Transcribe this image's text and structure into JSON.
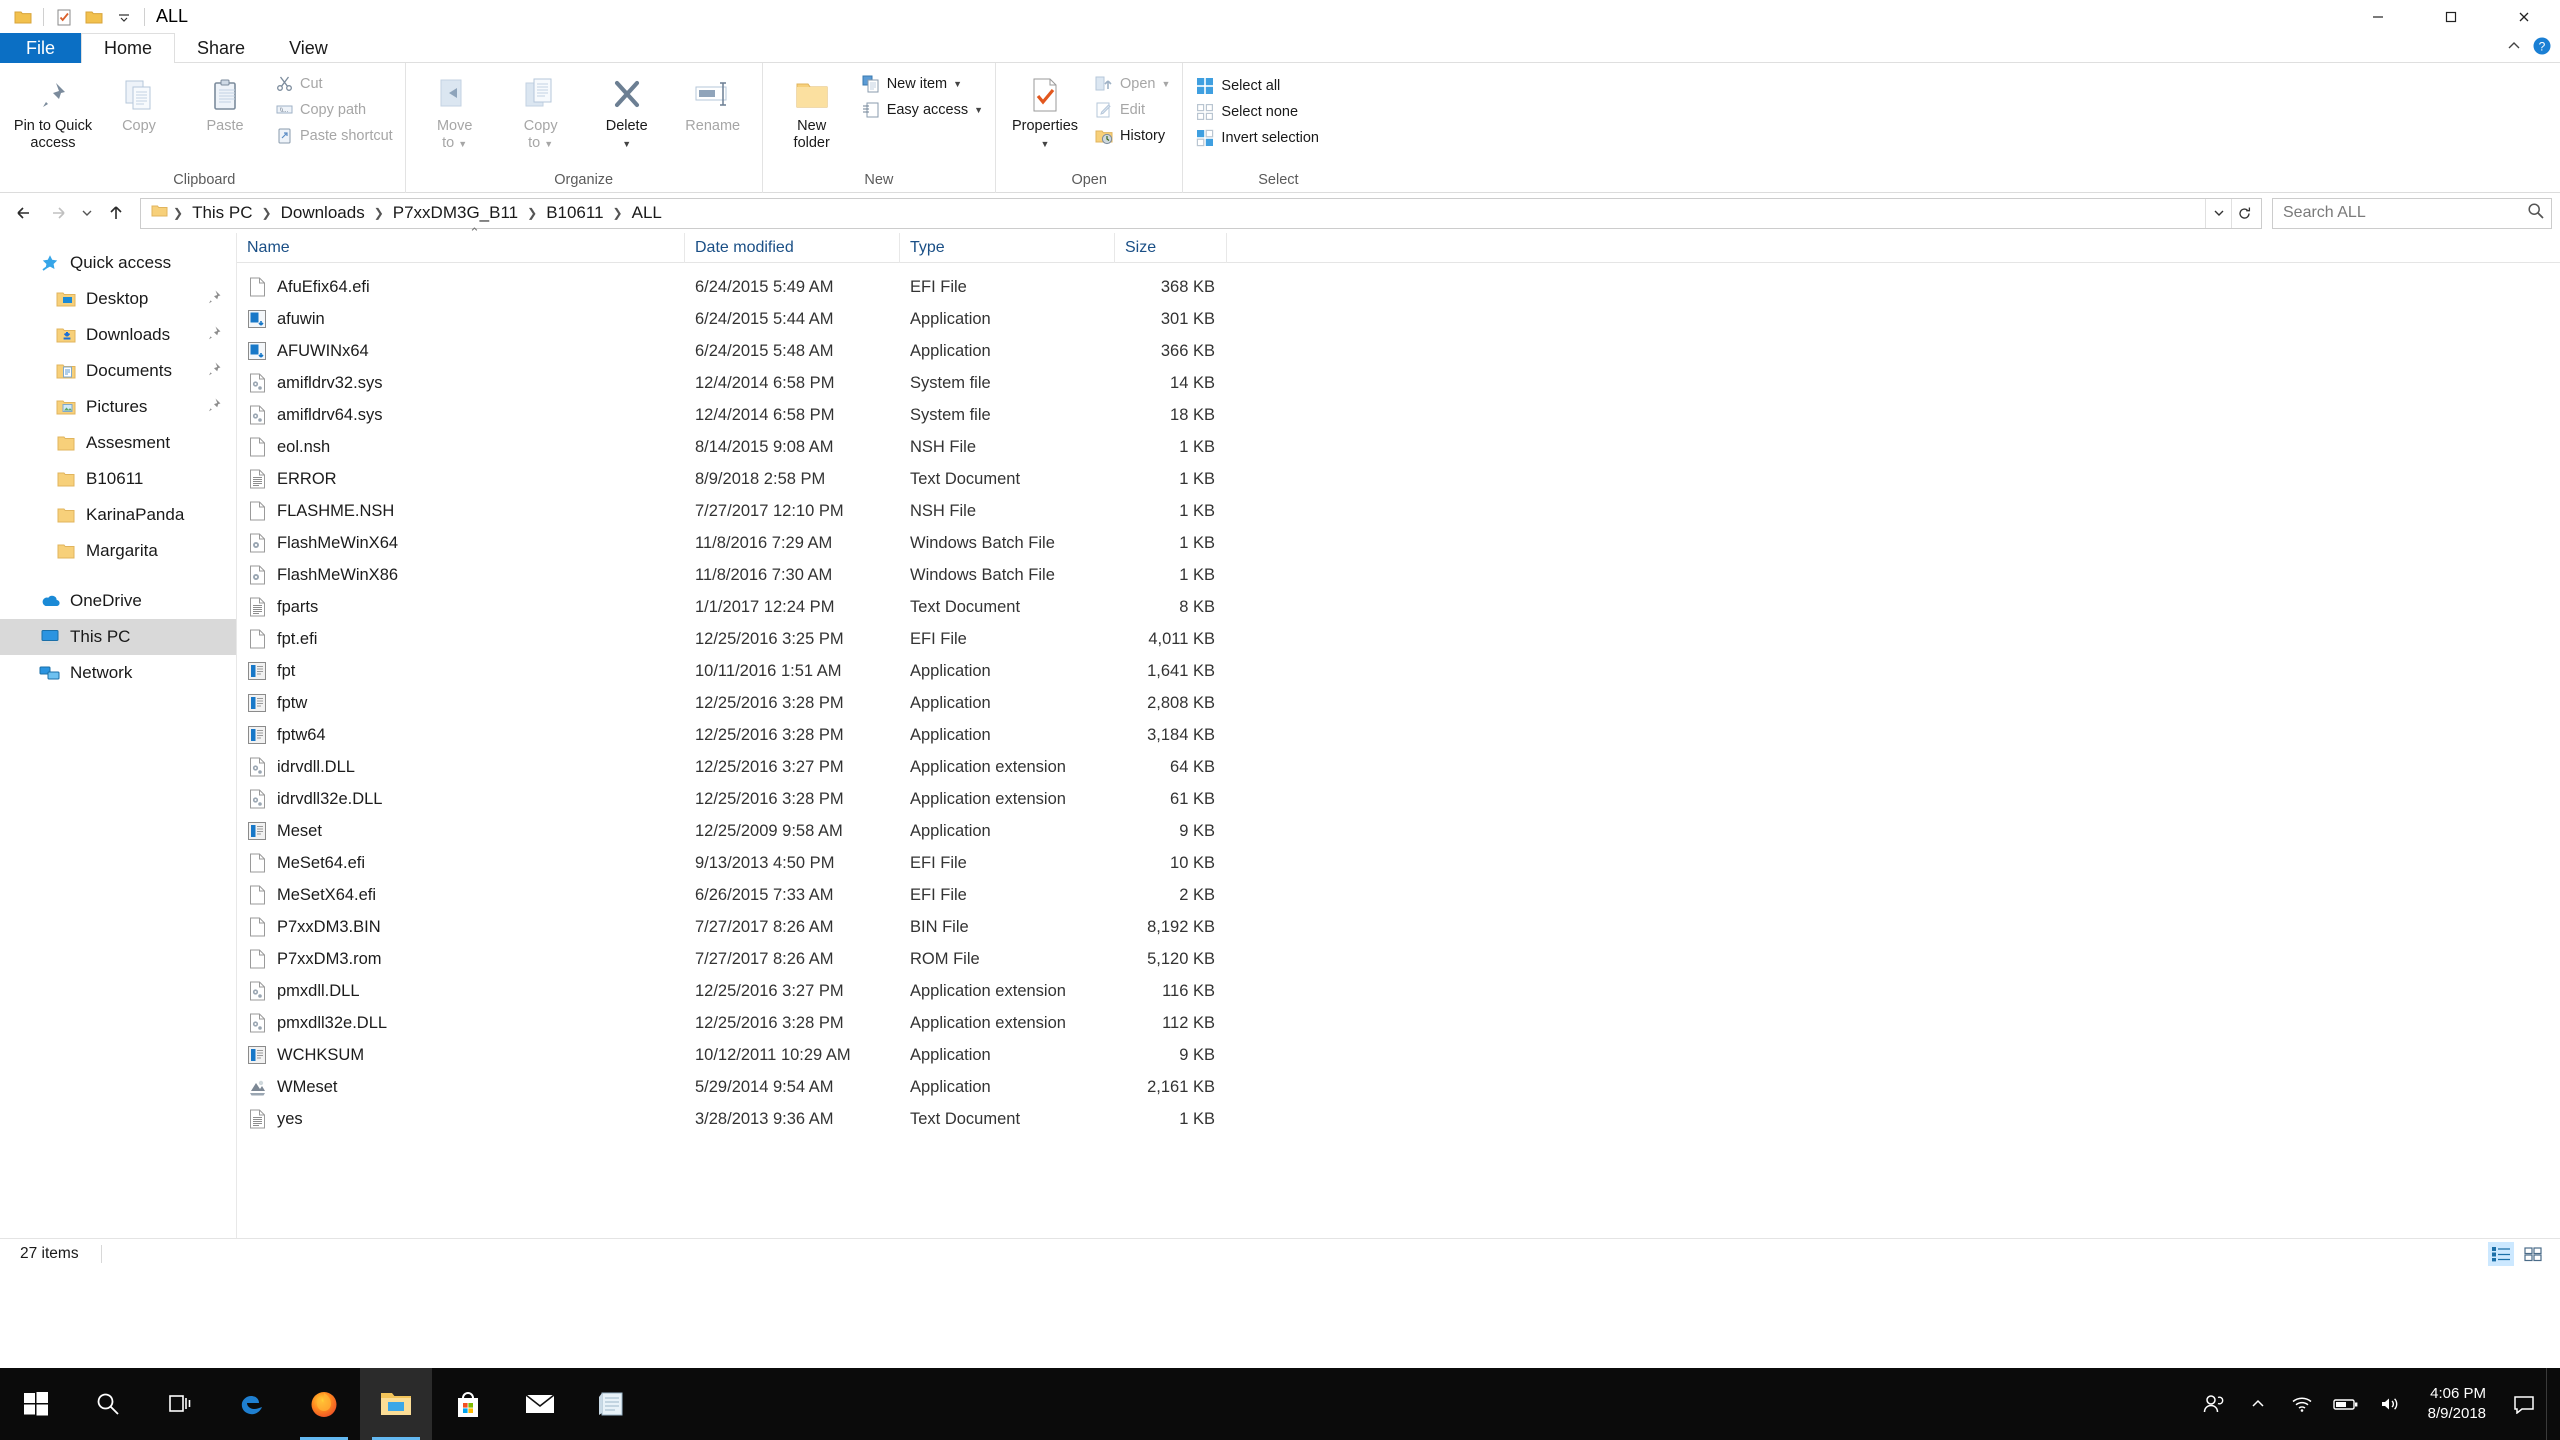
{
  "window": {
    "title": "ALL",
    "quick_access_buttons": [
      "folder-properties",
      "new-folder-checkmark",
      "folder"
    ],
    "dropdown": "customize-quick-access-toolbar",
    "minimize": "─",
    "maximize": "☐",
    "close": "✕"
  },
  "ribbon": {
    "tabs": [
      {
        "label": "File",
        "id": "file"
      },
      {
        "label": "Home",
        "id": "home"
      },
      {
        "label": "Share",
        "id": "share"
      },
      {
        "label": "View",
        "id": "view"
      }
    ],
    "active_tab": "Home",
    "collapse_icon": "chevron-up-icon",
    "help_icon": "?",
    "groups": [
      {
        "name": "Clipboard",
        "big_buttons": [
          {
            "label": "Pin to Quick\naccess",
            "line1": "Pin to Quick",
            "line2": "access",
            "icon": "pin-icon",
            "dim": false
          },
          {
            "label": "Copy",
            "icon": "copy-icon",
            "dim": true
          },
          {
            "label": "Paste",
            "icon": "paste-icon",
            "dim": true
          }
        ],
        "small_buttons": [
          {
            "label": "Cut",
            "icon": "scissors-icon",
            "dim": true
          },
          {
            "label": "Copy path",
            "icon": "copy-path-icon",
            "dim": true
          },
          {
            "label": "Paste shortcut",
            "icon": "paste-shortcut-icon",
            "dim": true
          }
        ]
      },
      {
        "name": "Organize",
        "big_buttons": [
          {
            "label": "Move",
            "line1": "Move",
            "line2": "to",
            "icon": "move-to-icon",
            "dim": true,
            "caret": true
          },
          {
            "label": "Copy",
            "line1": "Copy",
            "line2": "to",
            "icon": "copy-to-icon",
            "dim": true,
            "caret": true
          },
          {
            "label": "Delete",
            "line1": "Delete",
            "line2": "",
            "icon": "delete-x-icon",
            "dim": false,
            "caret": true
          },
          {
            "label": "Rename",
            "line1": "Rename",
            "line2": "",
            "icon": "rename-icon",
            "dim": true,
            "caret": false
          }
        ]
      },
      {
        "name": "New",
        "big_buttons": [
          {
            "label": "New",
            "line1": "New",
            "line2": "folder",
            "icon": "new-folder-icon",
            "dim": false
          }
        ],
        "small_buttons": [
          {
            "label": "New item",
            "icon": "new-item-icon",
            "dim": false,
            "caret": true
          },
          {
            "label": "Easy access",
            "icon": "easy-access-icon",
            "dim": false,
            "caret": true
          }
        ]
      },
      {
        "name": "Open",
        "big_buttons": [
          {
            "label": "Properties",
            "line1": "Properties",
            "line2": "",
            "icon": "properties-icon",
            "dim": false,
            "caret": true
          }
        ],
        "small_buttons": [
          {
            "label": "Open",
            "icon": "open-icon",
            "dim": true,
            "caret": true
          },
          {
            "label": "Edit",
            "icon": "edit-icon",
            "dim": true
          },
          {
            "label": "History",
            "icon": "history-icon",
            "dim": false
          }
        ]
      },
      {
        "name": "Select",
        "small_buttons": [
          {
            "label": "Select all",
            "icon": "select-all-icon",
            "dim": false
          },
          {
            "label": "Select none",
            "icon": "select-none-icon",
            "dim": false
          },
          {
            "label": "Invert selection",
            "icon": "invert-selection-icon",
            "dim": false
          }
        ]
      }
    ]
  },
  "addressbar": {
    "back_icon": "back-arrow-icon",
    "forward_icon": "forward-arrow-icon",
    "recent_icon": "chevron-down-icon",
    "up_icon": "up-arrow-icon",
    "breadcrumbs": [
      "This PC",
      "Downloads",
      "P7xxDM3G_B11",
      "B10611",
      "ALL"
    ],
    "dropdown_icon": "chevron-down-icon",
    "refresh_icon": "refresh-icon",
    "search_placeholder": "Search ALL",
    "search_value": "",
    "search_icon": "search-icon"
  },
  "sidebar": {
    "groups": [
      {
        "header": {
          "label": "Quick access",
          "icon": "star-pin-icon"
        },
        "items": [
          {
            "label": "Desktop",
            "icon": "folder-desktop-icon",
            "pinned": true
          },
          {
            "label": "Downloads",
            "icon": "folder-downloads-icon",
            "pinned": true
          },
          {
            "label": "Documents",
            "icon": "folder-documents-icon",
            "pinned": true
          },
          {
            "label": "Pictures",
            "icon": "folder-pictures-icon",
            "pinned": true
          },
          {
            "label": "Assesment",
            "icon": "folder-icon",
            "pinned": false
          },
          {
            "label": "B10611",
            "icon": "folder-icon",
            "pinned": false
          },
          {
            "label": "KarinaPanda",
            "icon": "folder-icon",
            "pinned": false
          },
          {
            "label": "Margarita",
            "icon": "folder-icon",
            "pinned": false
          }
        ]
      },
      {
        "items": [
          {
            "label": "OneDrive",
            "icon": "onedrive-cloud-icon",
            "root": true
          },
          {
            "label": "This PC",
            "icon": "this-pc-icon",
            "root": true,
            "selected": true
          },
          {
            "label": "Network",
            "icon": "network-icon",
            "root": true
          }
        ]
      }
    ]
  },
  "filelist": {
    "columns": [
      {
        "label": "Name",
        "key": "name"
      },
      {
        "label": "Date modified",
        "key": "date"
      },
      {
        "label": "Type",
        "key": "type"
      },
      {
        "label": "Size",
        "key": "size"
      }
    ],
    "sort_column": "Name",
    "sort_direction": "ascending",
    "rows": [
      {
        "name": "AfuEfix64.efi",
        "date": "6/24/2015 5:49 AM",
        "type": "EFI File",
        "size": "368 KB",
        "icon": "generic-file-icon"
      },
      {
        "name": "afuwin",
        "date": "6/24/2015 5:44 AM",
        "type": "Application",
        "size": "301 KB",
        "icon": "application-icon"
      },
      {
        "name": "AFUWINx64",
        "date": "6/24/2015 5:48 AM",
        "type": "Application",
        "size": "366 KB",
        "icon": "application-icon"
      },
      {
        "name": "amifldrv32.sys",
        "date": "12/4/2014 6:58 PM",
        "type": "System file",
        "size": "14 KB",
        "icon": "system-file-icon"
      },
      {
        "name": "amifldrv64.sys",
        "date": "12/4/2014 6:58 PM",
        "type": "System file",
        "size": "18 KB",
        "icon": "system-file-icon"
      },
      {
        "name": "eol.nsh",
        "date": "8/14/2015 9:08 AM",
        "type": "NSH File",
        "size": "1 KB",
        "icon": "generic-file-icon"
      },
      {
        "name": "ERROR",
        "date": "8/9/2018 2:58 PM",
        "type": "Text Document",
        "size": "1 KB",
        "icon": "text-document-icon"
      },
      {
        "name": "FLASHME.NSH",
        "date": "7/27/2017 12:10 PM",
        "type": "NSH File",
        "size": "1 KB",
        "icon": "generic-file-icon"
      },
      {
        "name": "FlashMeWinX64",
        "date": "11/8/2016 7:29 AM",
        "type": "Windows Batch File",
        "size": "1 KB",
        "icon": "batch-file-icon"
      },
      {
        "name": "FlashMeWinX86",
        "date": "11/8/2016 7:30 AM",
        "type": "Windows Batch File",
        "size": "1 KB",
        "icon": "batch-file-icon"
      },
      {
        "name": "fparts",
        "date": "1/1/2017 12:24 PM",
        "type": "Text Document",
        "size": "8 KB",
        "icon": "text-document-icon"
      },
      {
        "name": "fpt.efi",
        "date": "12/25/2016 3:25 PM",
        "type": "EFI File",
        "size": "4,011 KB",
        "icon": "generic-file-icon"
      },
      {
        "name": "fpt",
        "date": "10/11/2016 1:51 AM",
        "type": "Application",
        "size": "1,641 KB",
        "icon": "console-app-icon"
      },
      {
        "name": "fptw",
        "date": "12/25/2016 3:28 PM",
        "type": "Application",
        "size": "2,808 KB",
        "icon": "console-app-icon"
      },
      {
        "name": "fptw64",
        "date": "12/25/2016 3:28 PM",
        "type": "Application",
        "size": "3,184 KB",
        "icon": "console-app-icon"
      },
      {
        "name": "idrvdll.DLL",
        "date": "12/25/2016 3:27 PM",
        "type": "Application extension",
        "size": "64 KB",
        "icon": "dll-icon"
      },
      {
        "name": "idrvdll32e.DLL",
        "date": "12/25/2016 3:28 PM",
        "type": "Application extension",
        "size": "61 KB",
        "icon": "dll-icon"
      },
      {
        "name": "Meset",
        "date": "12/25/2009 9:58 AM",
        "type": "Application",
        "size": "9 KB",
        "icon": "console-app-icon"
      },
      {
        "name": "MeSet64.efi",
        "date": "9/13/2013 4:50 PM",
        "type": "EFI File",
        "size": "10 KB",
        "icon": "generic-file-icon"
      },
      {
        "name": "MeSetX64.efi",
        "date": "6/26/2015 7:33 AM",
        "type": "EFI File",
        "size": "2 KB",
        "icon": "generic-file-icon"
      },
      {
        "name": "P7xxDM3.BIN",
        "date": "7/27/2017 8:26 AM",
        "type": "BIN File",
        "size": "8,192 KB",
        "icon": "generic-file-icon"
      },
      {
        "name": "P7xxDM3.rom",
        "date": "7/27/2017 8:26 AM",
        "type": "ROM File",
        "size": "5,120 KB",
        "icon": "generic-file-icon"
      },
      {
        "name": "pmxdll.DLL",
        "date": "12/25/2016 3:27 PM",
        "type": "Application extension",
        "size": "116 KB",
        "icon": "dll-icon"
      },
      {
        "name": "pmxdll32e.DLL",
        "date": "12/25/2016 3:28 PM",
        "type": "Application extension",
        "size": "112 KB",
        "icon": "dll-icon"
      },
      {
        "name": "WCHKSUM",
        "date": "10/12/2011 10:29 AM",
        "type": "Application",
        "size": "9 KB",
        "icon": "console-app-icon"
      },
      {
        "name": "WMeset",
        "date": "5/29/2014 9:54 AM",
        "type": "Application",
        "size": "2,161 KB",
        "icon": "app-window-icon"
      },
      {
        "name": "yes",
        "date": "3/28/2013 9:36 AM",
        "type": "Text Document",
        "size": "1 KB",
        "icon": "text-document-icon"
      }
    ]
  },
  "statusbar": {
    "item_count": "27 items",
    "view_details_icon": "details-view-icon",
    "view_tiles_icon": "large-icons-view-icon"
  },
  "taskbar": {
    "start_icon": "windows-start-icon",
    "search_icon": "search-icon",
    "taskview_icon": "task-view-icon",
    "apps": [
      {
        "name": "microsoft-edge",
        "running": false
      },
      {
        "name": "firefox",
        "running": true
      },
      {
        "name": "file-explorer",
        "running": true,
        "active": true
      },
      {
        "name": "microsoft-store",
        "running": false
      },
      {
        "name": "mail",
        "running": false
      },
      {
        "name": "notepad",
        "running": false
      }
    ],
    "tray": [
      {
        "name": "people-icon"
      },
      {
        "name": "show-hidden-icons-chevron"
      },
      {
        "name": "network-wifi-icon"
      },
      {
        "name": "battery-icon"
      },
      {
        "name": "volume-icon"
      }
    ],
    "clock_time": "4:06 PM",
    "clock_date": "8/9/2018",
    "action_center_icon": "action-center-icon"
  },
  "colors": {
    "accent": "#0b6fc4",
    "selection": "#cce8ff",
    "folder_yellow": "#f7d07a",
    "taskbar_bg": "#0b0b0b",
    "header_text": "#1a4f86"
  }
}
